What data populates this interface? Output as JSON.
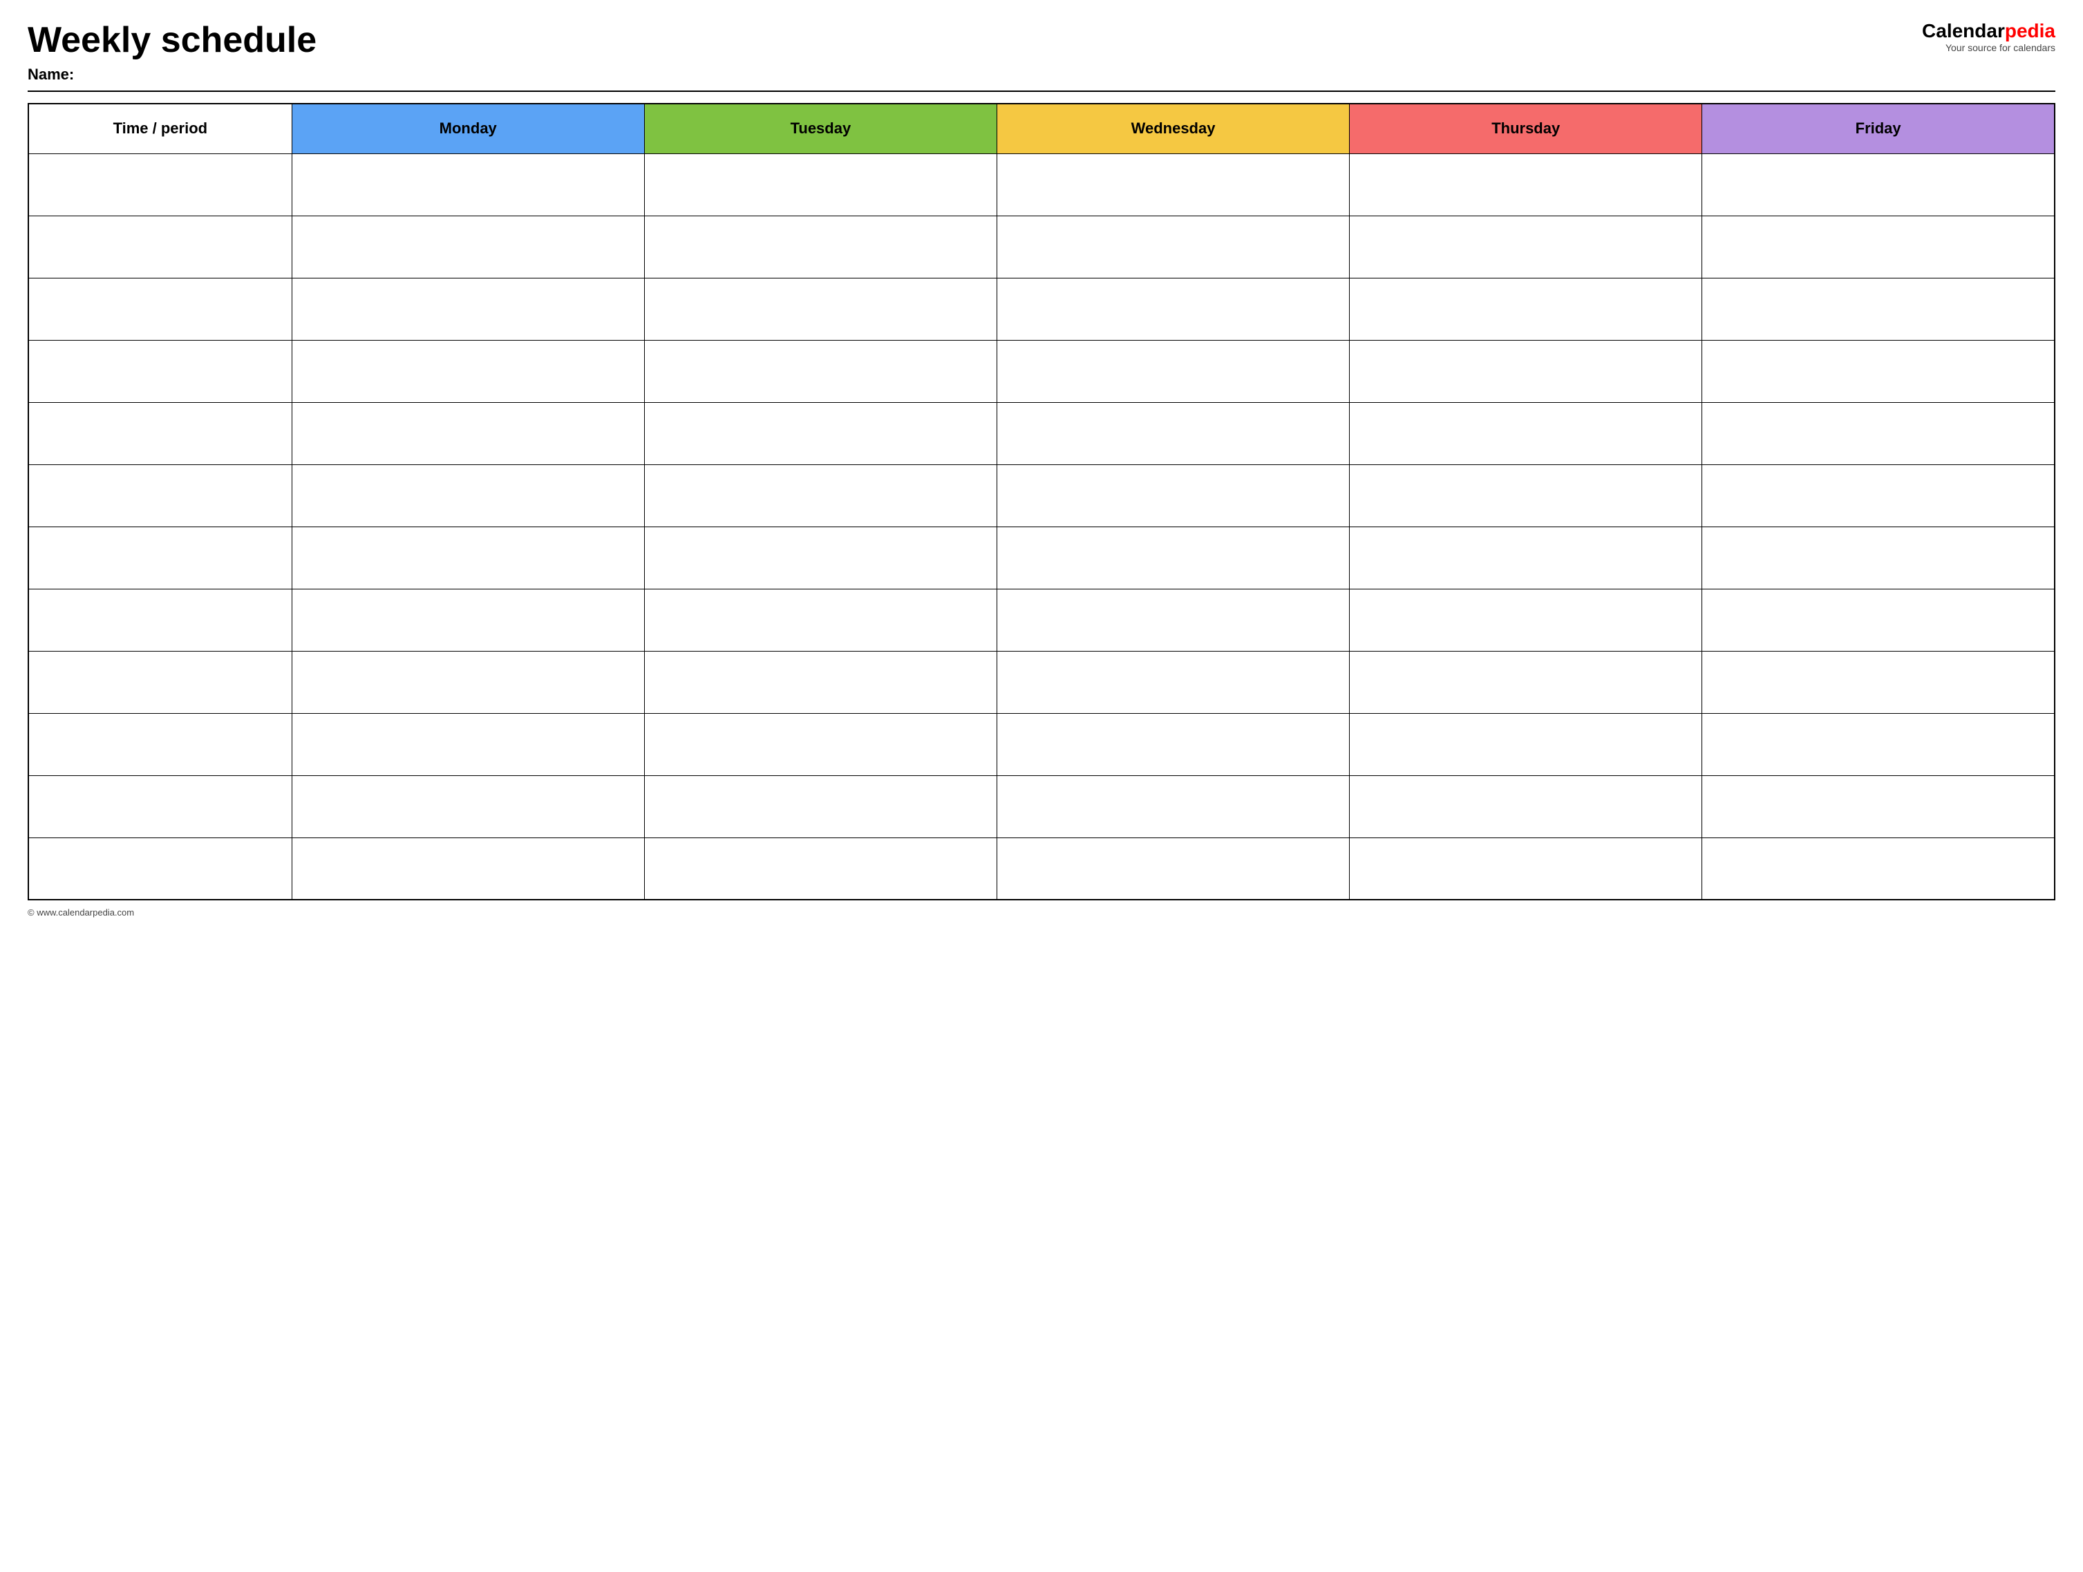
{
  "header": {
    "title": "Weekly schedule",
    "name_label": "Name:",
    "logo_calendar": "Calendar",
    "logo_pedia": "pedia",
    "logo_tagline": "Your source for calendars"
  },
  "table": {
    "columns": [
      {
        "key": "time",
        "label": "Time / period",
        "color_class": "col-time"
      },
      {
        "key": "monday",
        "label": "Monday",
        "color_class": "col-monday"
      },
      {
        "key": "tuesday",
        "label": "Tuesday",
        "color_class": "col-tuesday"
      },
      {
        "key": "wednesday",
        "label": "Wednesday",
        "color_class": "col-wednesday"
      },
      {
        "key": "thursday",
        "label": "Thursday",
        "color_class": "col-thursday"
      },
      {
        "key": "friday",
        "label": "Friday",
        "color_class": "col-friday"
      }
    ],
    "row_count": 12
  },
  "footer": {
    "url": "© www.calendarpedia.com"
  },
  "colors": {
    "monday": "#5ba3f5",
    "tuesday": "#7fc241",
    "wednesday": "#f5c842",
    "thursday": "#f56b6b",
    "friday": "#b48fe0"
  }
}
